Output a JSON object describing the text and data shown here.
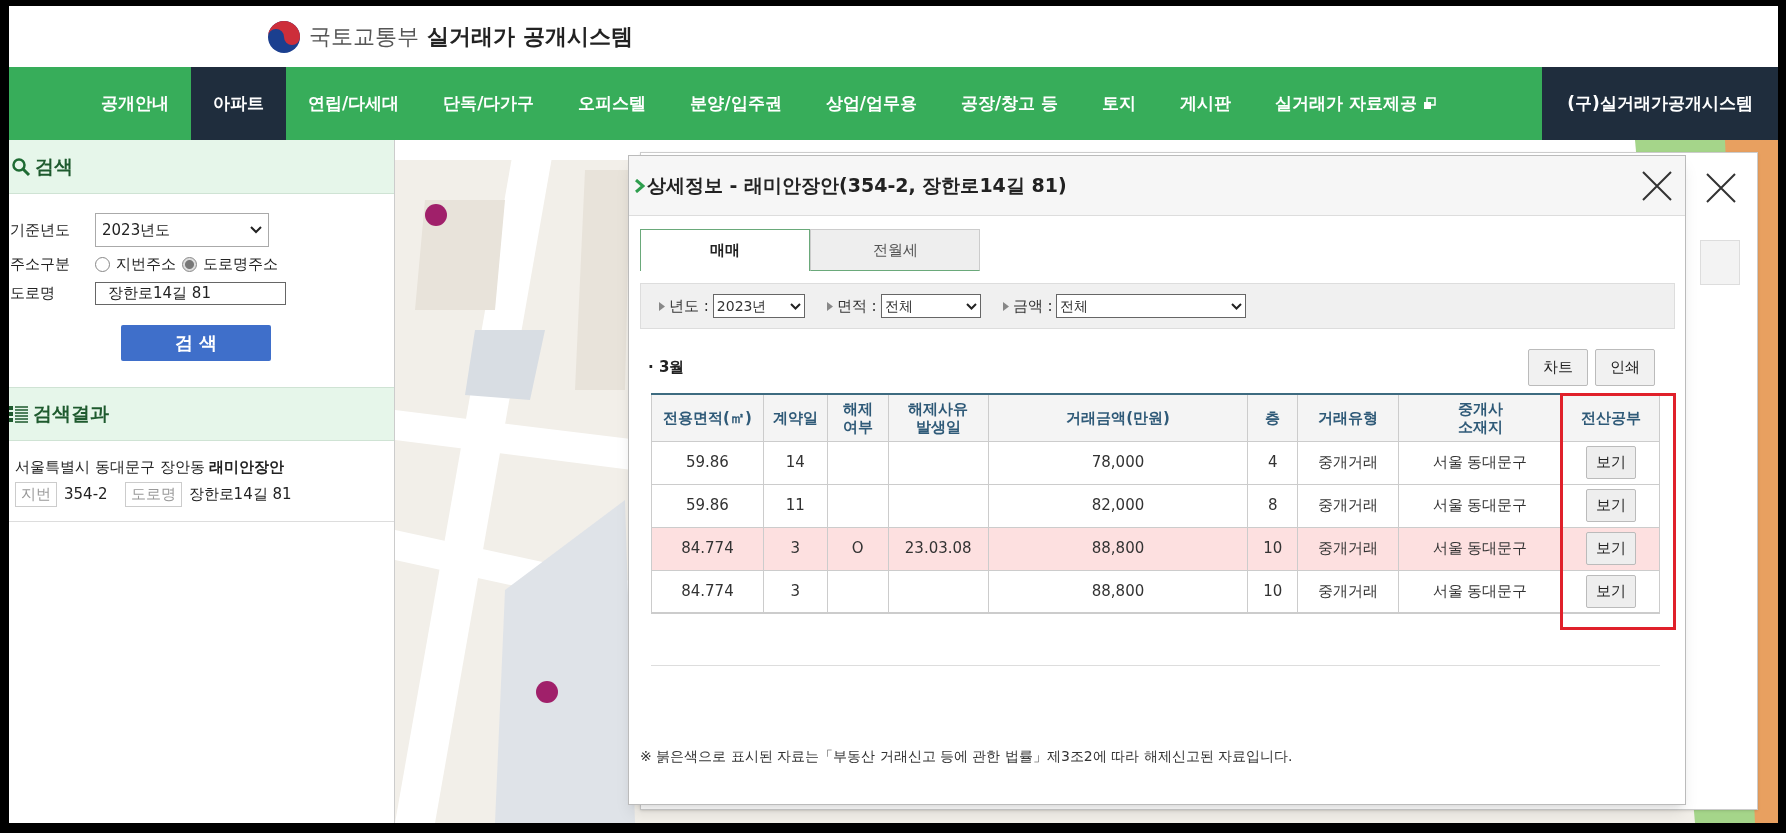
{
  "header": {
    "ministry": "국토교통부",
    "system": "실거래가 공개시스템"
  },
  "nav": [
    {
      "label": "공개안내",
      "selected": false,
      "external": false
    },
    {
      "label": "아파트",
      "selected": true,
      "external": false
    },
    {
      "label": "연립/다세대",
      "selected": false,
      "external": false
    },
    {
      "label": "단독/다가구",
      "selected": false,
      "external": false
    },
    {
      "label": "오피스텔",
      "selected": false,
      "external": false
    },
    {
      "label": "분양/입주권",
      "selected": false,
      "external": false
    },
    {
      "label": "상업/업무용",
      "selected": false,
      "external": false
    },
    {
      "label": "공장/창고 등",
      "selected": false,
      "external": false
    },
    {
      "label": "토지",
      "selected": false,
      "external": false
    },
    {
      "label": "게시판",
      "selected": false,
      "external": false
    },
    {
      "label": "실거래가 자료제공",
      "selected": false,
      "external": true
    }
  ],
  "legacy_link": "(구)실거래가공개시스템",
  "search": {
    "title": "검색",
    "year_label": "기준년도",
    "year_value": "2023년도",
    "address_type_label": "주소구분",
    "address_types": [
      {
        "label": "지번주소",
        "selected": false
      },
      {
        "label": "도로명주소",
        "selected": true
      }
    ],
    "road_label": "도로명",
    "road_value": "장한로14길 81",
    "button": "검 색"
  },
  "results": {
    "title": "검색결과",
    "items": [
      {
        "address": "서울특별시 동대문구 장안동 **래미안장안**",
        "lot_tag": "지번",
        "lot": "354-2",
        "road_tag": "도로명",
        "road": "장한로14길 81"
      }
    ]
  },
  "modal": {
    "title": "상세정보 - 래미안장안(354-2, 장한로14길 81)",
    "tabs": [
      {
        "label": "매매",
        "selected": true
      },
      {
        "label": "전월세",
        "selected": false
      }
    ],
    "filters": [
      {
        "label": "년도 :",
        "value": "2023년"
      },
      {
        "label": "면적 :",
        "value": "전체"
      },
      {
        "label": "금액 :",
        "value": "전체"
      }
    ],
    "month": "· 3월",
    "buttons": [
      "차트",
      "인쇄"
    ],
    "columns": [
      "전용면적(㎡)",
      "계약일",
      "해제\n여부",
      "해제사유\n발생일",
      "거래금액(만원)",
      "층",
      "거래유형",
      "중개사\n소재지",
      "전산공부"
    ],
    "rows": [
      {
        "cancelled": false,
        "cells": [
          "59.86",
          "14",
          "",
          "",
          "78,000",
          "4",
          "중개거래",
          "서울 동대문구"
        ],
        "button": "보기"
      },
      {
        "cancelled": false,
        "cells": [
          "59.86",
          "11",
          "",
          "",
          "82,000",
          "8",
          "중개거래",
          "서울 동대문구"
        ],
        "button": "보기"
      },
      {
        "cancelled": true,
        "cells": [
          "84.774",
          "3",
          "O",
          "23.03.08",
          "88,800",
          "10",
          "중개거래",
          "서울 동대문구"
        ],
        "button": "보기"
      },
      {
        "cancelled": false,
        "cells": [
          "84.774",
          "3",
          "",
          "",
          "88,800",
          "10",
          "중개거래",
          "서울 동대문구"
        ],
        "button": "보기"
      }
    ],
    "note": "※ 붉은색으로 표시된 자료는「부동산 거래신고 등에 관한 법률」제3조2에 따라 해제신고된 자료입니다."
  }
}
